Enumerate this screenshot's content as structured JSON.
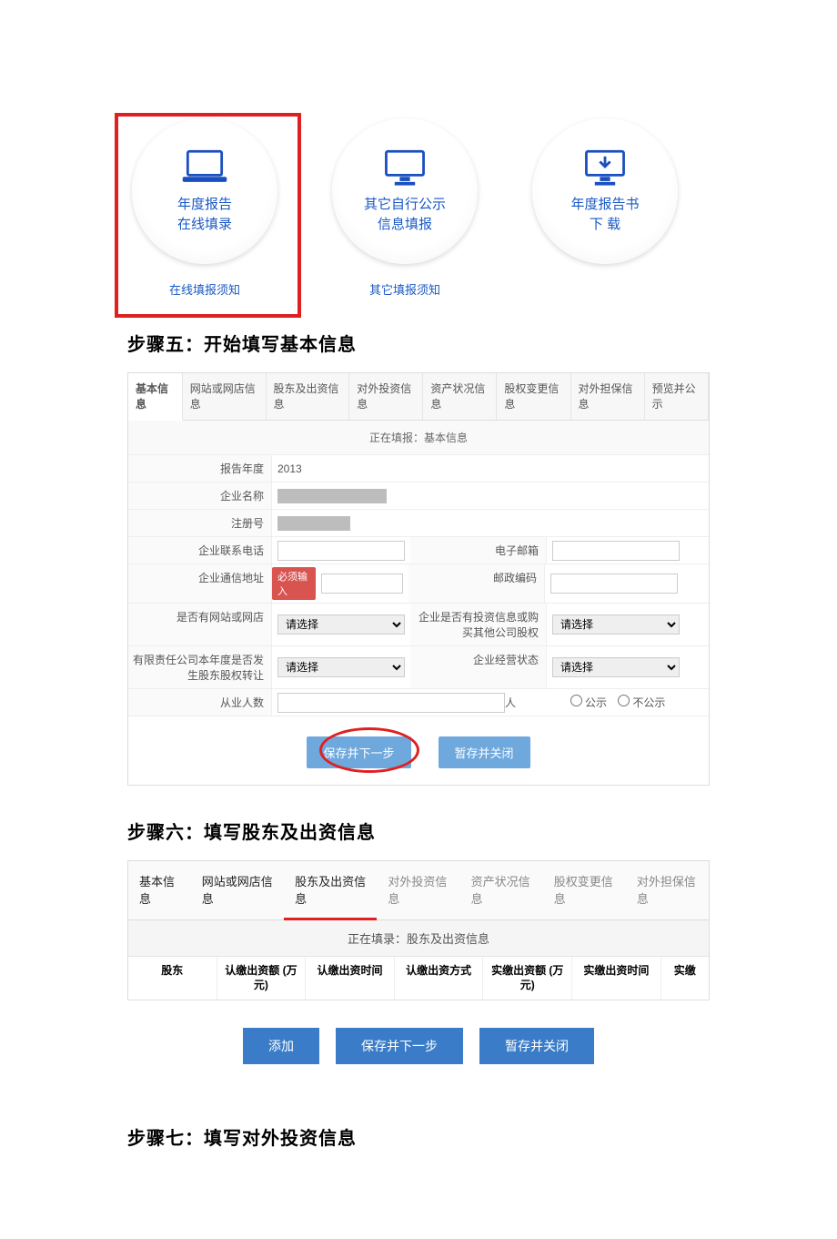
{
  "circles": [
    {
      "line1": "年度报告",
      "line2": "在线填录",
      "sub": "在线填报须知"
    },
    {
      "line1": "其它自行公示",
      "line2": "信息填报",
      "sub": "其它填报须知"
    },
    {
      "line1": "年度报告书",
      "line2": "下 载",
      "sub": ""
    }
  ],
  "step5": {
    "heading": "步骤五：开始填写基本信息",
    "tabs": [
      "基本信息",
      "网站或网店信息",
      "股东及出资信息",
      "对外投资信息",
      "资产状况信息",
      "股权变更信息",
      "对外担保信息",
      "预览并公示"
    ],
    "title": "正在填报：基本信息",
    "rows": {
      "year_label": "报告年度",
      "year_value": "2013",
      "name_label": "企业名称",
      "regno_label": "注册号",
      "phone_label": "企业联系电话",
      "email_label": "电子邮箱",
      "addr_label": "企业通信地址",
      "addr_tip": "必须输入",
      "post_label": "邮政编码",
      "hassite_label": "是否有网站或网店",
      "select_ph": "请选择",
      "invest_label": "企业是否有投资信息或购买其他公司股权",
      "transfer_label": "有限责任公司本年度是否发生股东股权转让",
      "status_label": "企业经营状态",
      "emp_label": "从业人数",
      "emp_unit": "人",
      "pub_yes": "公示",
      "pub_no": "不公示"
    },
    "btn_save": "保存并下一步",
    "btn_close": "暂存并关闭"
  },
  "step6": {
    "heading": "步骤六：填写股东及出资信息",
    "tabs": [
      "基本信息",
      "网站或网店信息",
      "股东及出资信息",
      "对外投资信息",
      "资产状况信息",
      "股权变更信息",
      "对外担保信息"
    ],
    "title": "正在填录：股东及出资信息",
    "cols": [
      "股东",
      "认缴出资额 (万元)",
      "认缴出资时间",
      "认缴出资方式",
      "实缴出资额 (万元)",
      "实缴出资时间",
      "实缴"
    ],
    "btn_add": "添加",
    "btn_save": "保存并下一步",
    "btn_close": "暂存并关闭"
  },
  "step7": {
    "heading": "步骤七：填写对外投资信息"
  }
}
